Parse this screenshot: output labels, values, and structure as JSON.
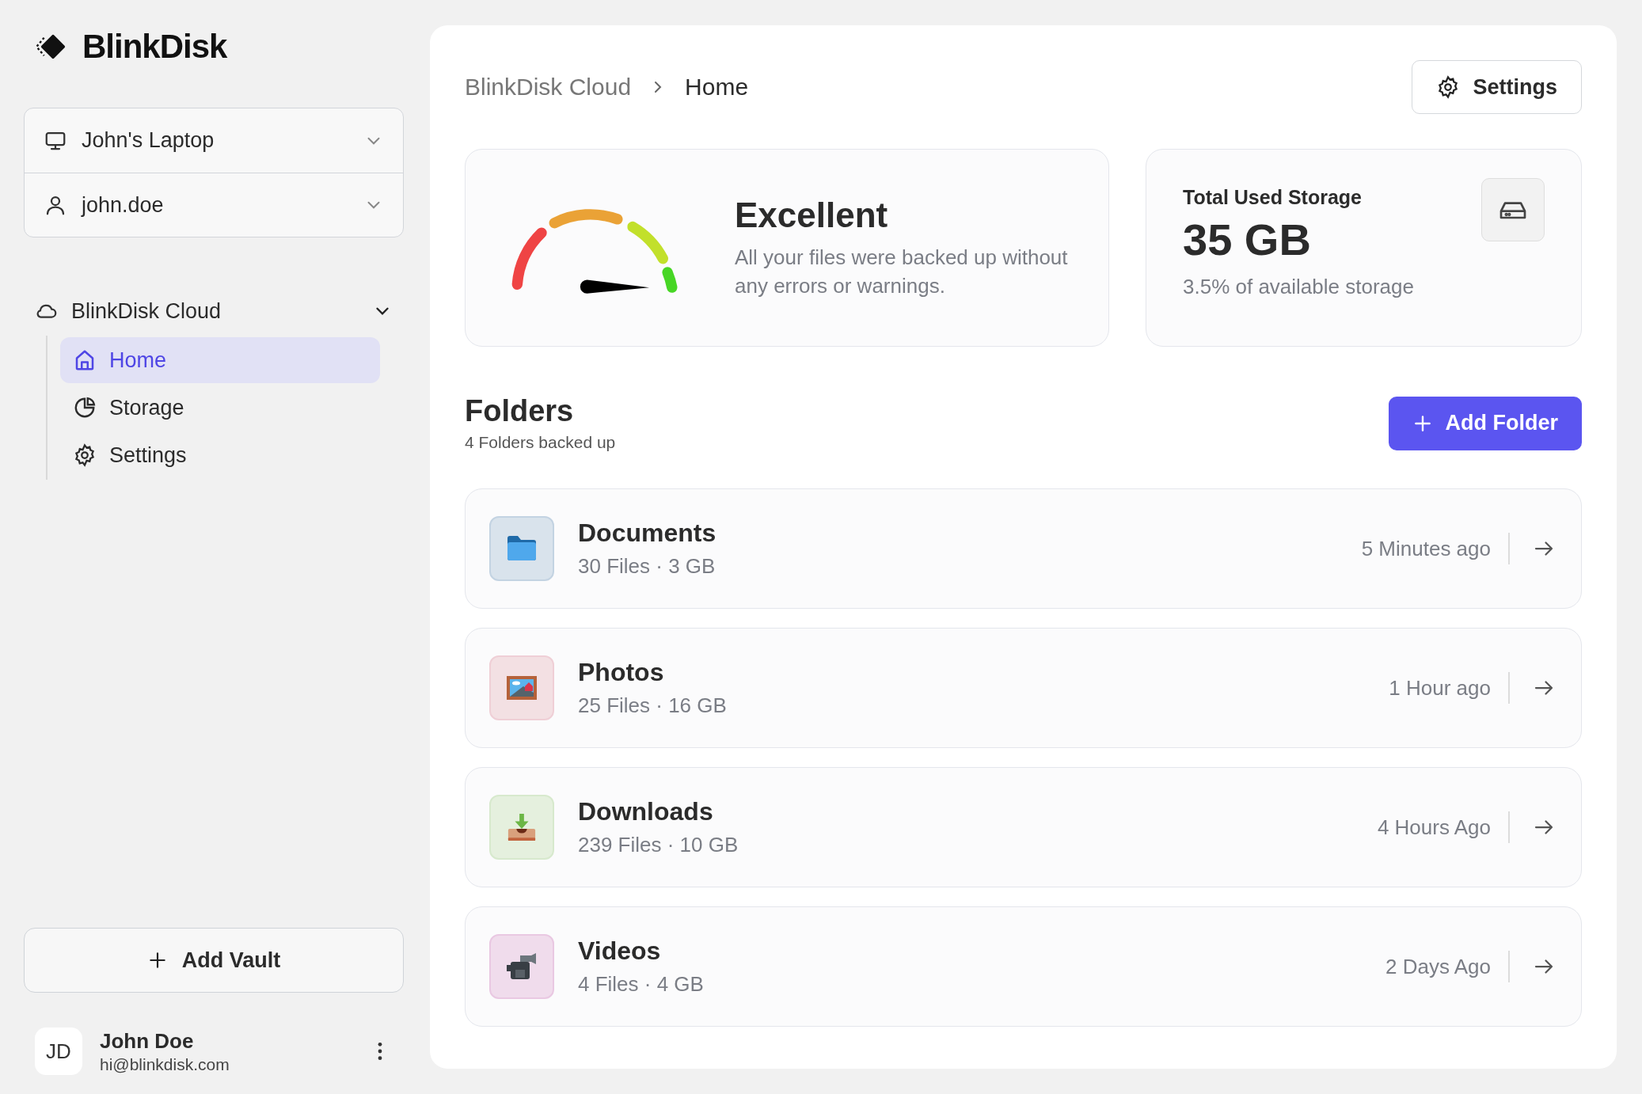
{
  "app": {
    "name": "BlinkDisk"
  },
  "selectors": [
    {
      "kind": "device",
      "value": "John's Laptop"
    },
    {
      "kind": "user",
      "value": "john.doe"
    }
  ],
  "vault": {
    "name": "BlinkDisk Cloud",
    "expanded": true,
    "items": [
      {
        "kind": "home",
        "label": "Home",
        "selected": true
      },
      {
        "kind": "storage",
        "label": "Storage",
        "selected": false
      },
      {
        "kind": "settings",
        "label": "Settings",
        "selected": false
      }
    ]
  },
  "add_vault": "Add Vault",
  "account": {
    "initials": "JD",
    "name": "John Doe",
    "email": "hi@blinkdisk.com"
  },
  "breadcrumb": [
    "BlinkDisk Cloud",
    "Home"
  ],
  "settings_button": "Settings",
  "health": {
    "title": "Excellent",
    "text": "All your files were backed up without any errors or warnings."
  },
  "storage": {
    "label": "Total Used Storage",
    "value": "35 GB",
    "note": "3.5% of available storage"
  },
  "folders_section": {
    "title": "Folders",
    "subtitle": "4 Folders backed up",
    "add_button": "Add Folder"
  },
  "folders": [
    {
      "kind": "documents",
      "name": "Documents",
      "meta": "30 Files · 3 GB",
      "time": "5 Minutes ago"
    },
    {
      "kind": "photos",
      "name": "Photos",
      "meta": "25 Files · 16 GB",
      "time": "1 Hour ago"
    },
    {
      "kind": "downloads",
      "name": "Downloads",
      "meta": "239 Files · 10 GB",
      "time": "4 Hours Ago"
    },
    {
      "kind": "videos",
      "name": "Videos",
      "meta": "4 Files · 4 GB",
      "time": "2 Days Ago"
    }
  ]
}
